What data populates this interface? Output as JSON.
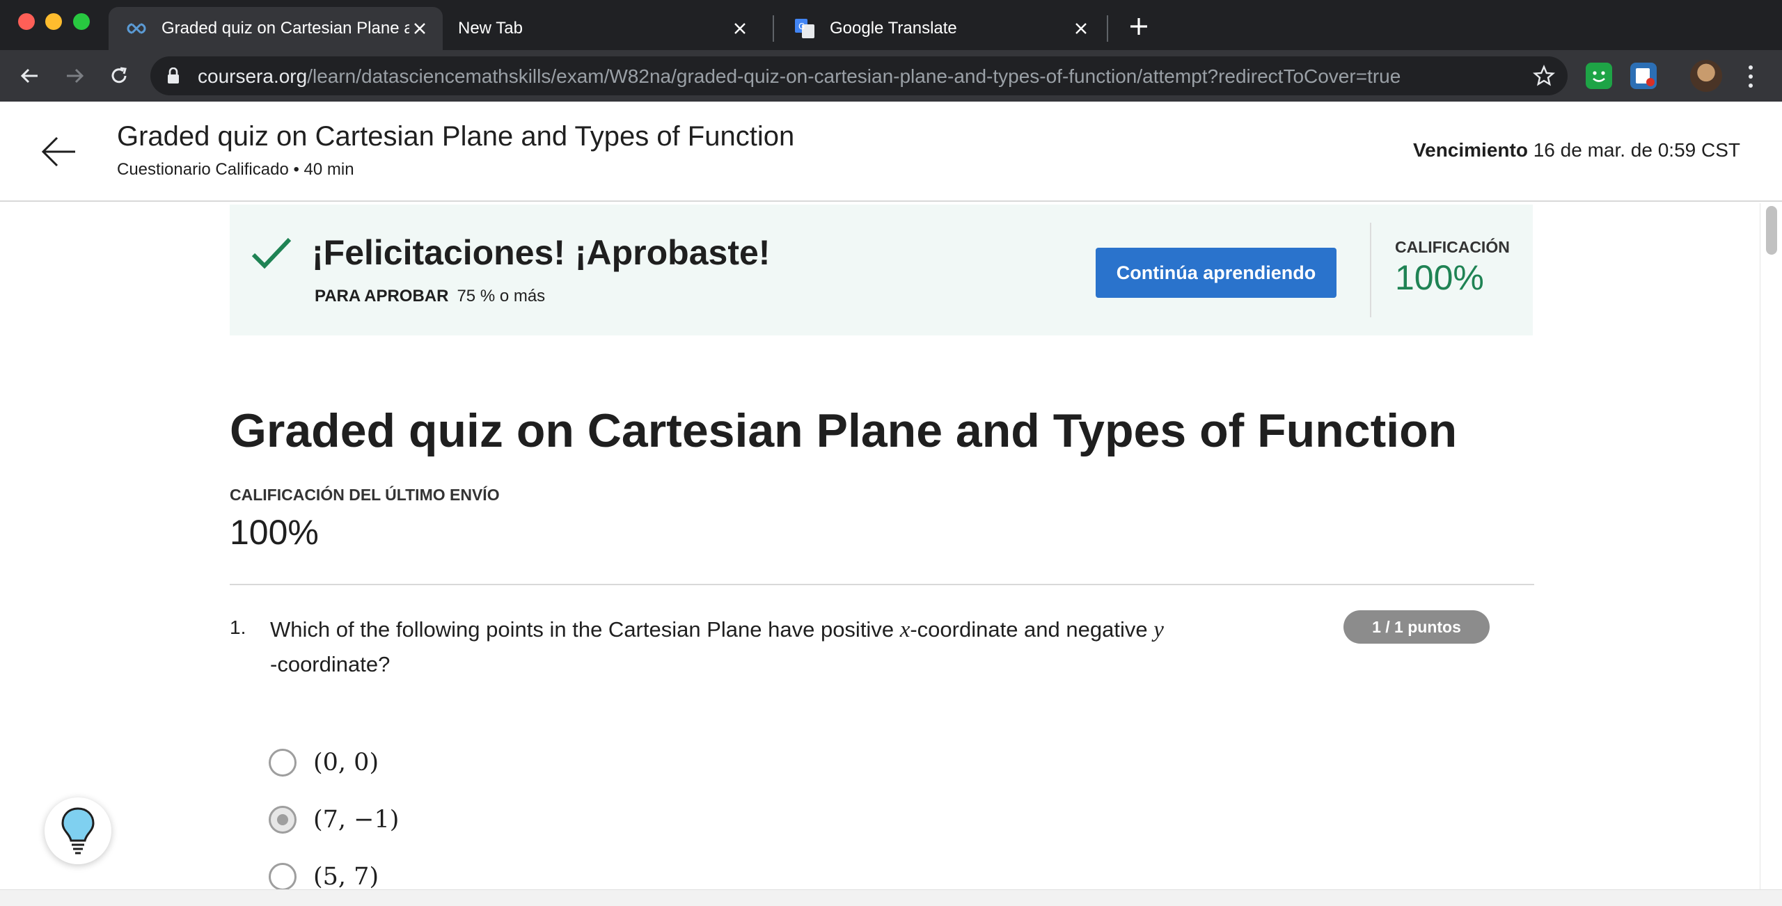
{
  "browser": {
    "tabs": [
      {
        "title": "Graded quiz on Cartesian Plane and Types of Function",
        "active": true,
        "icon": "coursera-icon"
      },
      {
        "title": "New Tab",
        "active": false
      },
      {
        "title": "Google Translate",
        "active": false,
        "icon": "google-translate-icon"
      }
    ],
    "url_host": "coursera.org",
    "url_path": "/learn/datasciencemathskills/exam/W82na/graded-quiz-on-cartesian-plane-and-types-of-function/attempt?redirectToCover=true"
  },
  "header": {
    "title": "Graded quiz on Cartesian Plane and Types of Function",
    "subtitle": "Cuestionario Calificado • 40 min",
    "due_label": "Vencimiento",
    "due_value": "16 de mar. de 0:59 CST"
  },
  "banner": {
    "message": "¡Felicitaciones! ¡Aprobaste!",
    "pass_label": "PARA APROBAR",
    "pass_value": "75 % o más",
    "button_label": "Continúa aprendiendo",
    "grade_label": "CALIFICACIÓN",
    "grade_value": "100%"
  },
  "quiz": {
    "title": "Graded quiz on Cartesian Plane and Types of Function",
    "last_submission_label": "CALIFICACIÓN DEL ÚLTIMO ENVÍO",
    "last_submission_value": "100%"
  },
  "question": {
    "number": "1.",
    "text_part1": "Which of the following points in the Cartesian Plane have positive ",
    "var_x": "x",
    "text_part2": "-coordinate and negative ",
    "var_y": "y",
    "text_part3": "-coordinate?",
    "points": "1 / 1 puntos",
    "options": [
      {
        "label": "(0, 0)",
        "selected": false
      },
      {
        "label": "(7, −1)",
        "selected": true
      },
      {
        "label": "(5, 7)",
        "selected": false
      }
    ]
  },
  "colors": {
    "accent_blue": "#2a73cc",
    "success_green": "#1f8354",
    "banner_bg": "#f1f8f6",
    "browser_dark": "#202124"
  }
}
